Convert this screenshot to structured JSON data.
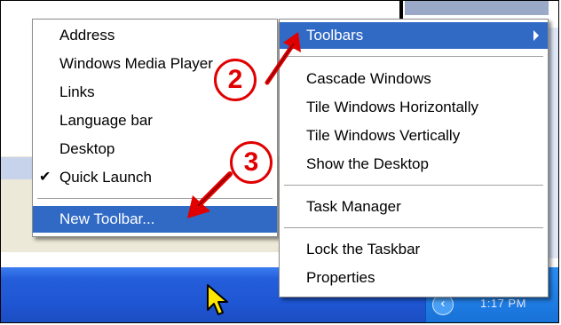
{
  "taskbar_menu": {
    "items": [
      {
        "label": "Toolbars",
        "highlighted": true,
        "has_submenu": true
      },
      {
        "label": "Cascade Windows"
      },
      {
        "label": "Tile Windows Horizontally"
      },
      {
        "label": "Tile Windows Vertically"
      },
      {
        "label": "Show the Desktop"
      },
      {
        "label": "Task Manager"
      },
      {
        "label": "Lock the Taskbar"
      },
      {
        "label": "Properties"
      }
    ]
  },
  "toolbars_submenu": {
    "items": [
      {
        "label": "Address"
      },
      {
        "label": "Windows Media Player"
      },
      {
        "label": "Links"
      },
      {
        "label": "Language bar"
      },
      {
        "label": "Desktop"
      },
      {
        "label": "Quick Launch",
        "checked": true
      },
      {
        "label": "New Toolbar...",
        "highlighted": true
      }
    ]
  },
  "annotations": {
    "step_2": "2",
    "step_3": "3",
    "annotation_color": "#e00000"
  },
  "taskbar": {
    "clock": "1:17 PM",
    "chevron": "‹"
  },
  "colors": {
    "highlight": "#316ac5",
    "taskbar": "#245edb"
  }
}
